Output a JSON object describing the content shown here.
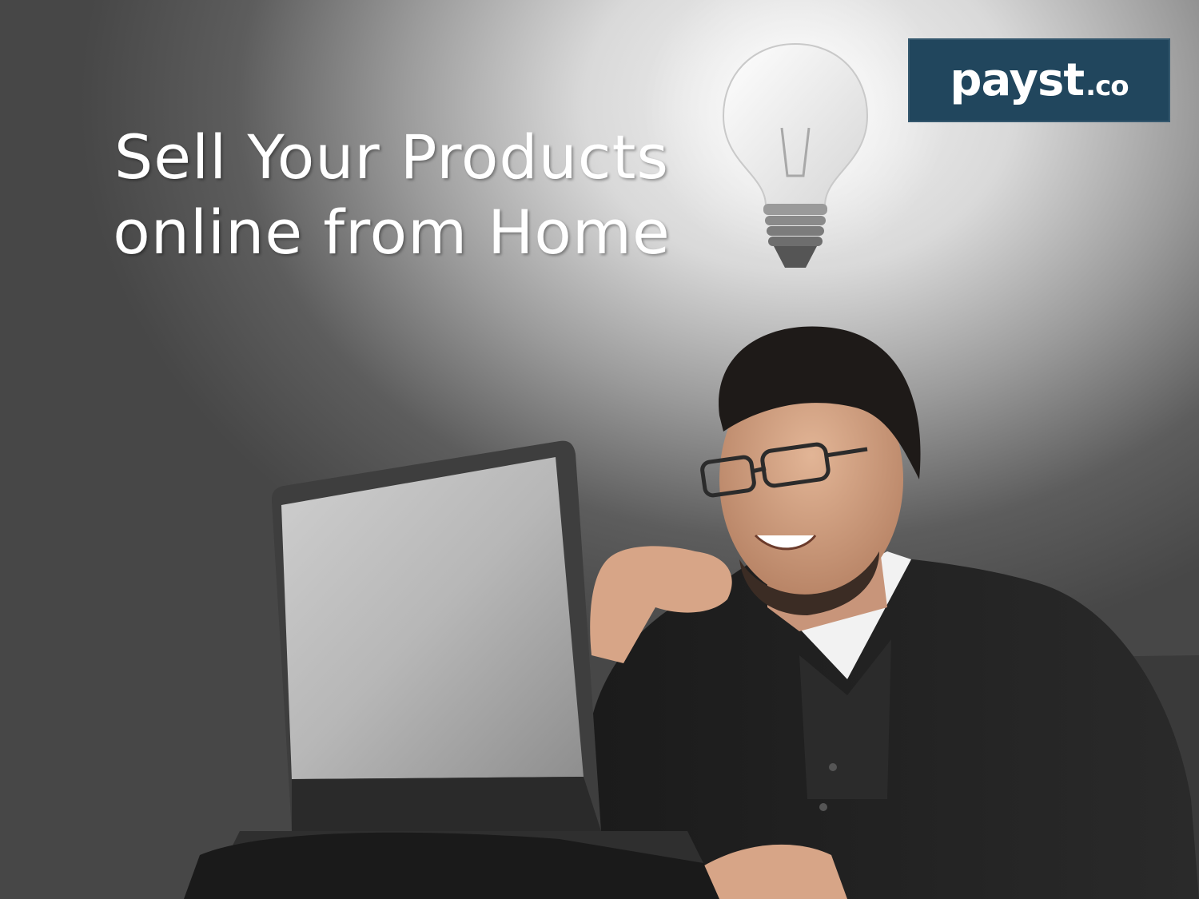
{
  "headline": {
    "line1": "Sell Your Products",
    "line2": "online from Home"
  },
  "logo": {
    "name": "payst",
    "suffix": ".co",
    "background": "#21465d"
  },
  "colors": {
    "headline_text": "#ffffff",
    "background_dark": "#474747",
    "background_light": "#f4f4f4"
  }
}
